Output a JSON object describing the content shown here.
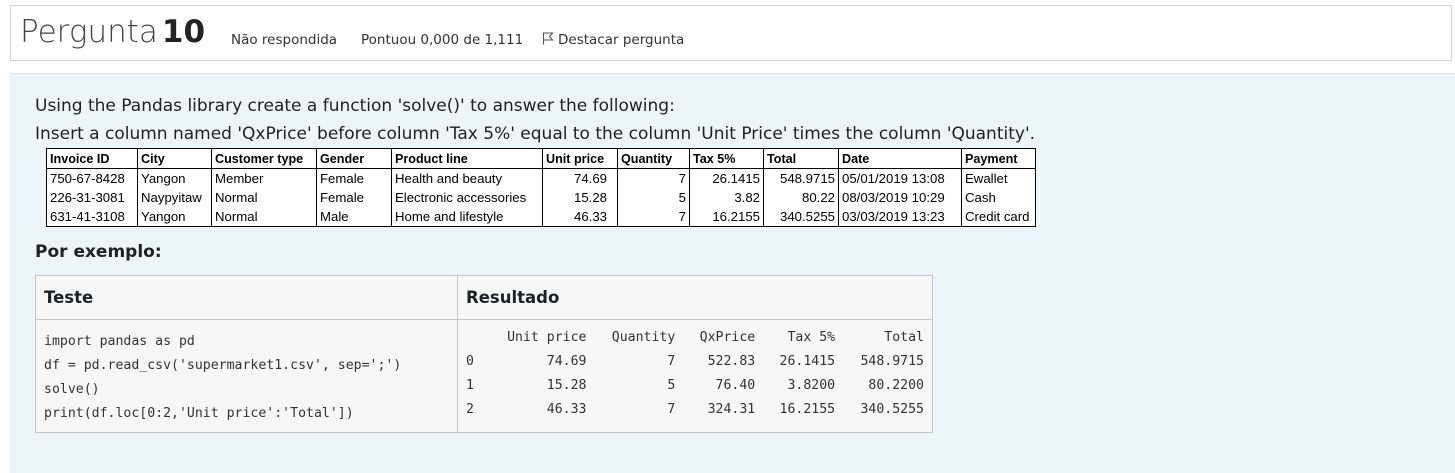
{
  "question": {
    "label": "Pergunta",
    "number": "10",
    "status": "Não respondida",
    "score": "Pontuou 0,000 de 1,111",
    "flag_label": "Destacar pergunta",
    "flag_icon": "flag-outline-icon"
  },
  "prompt": {
    "line1": "Using the Pandas library create a function 'solve()' to answer the following:",
    "line2": "Insert a column named 'QxPrice' before column 'Tax 5%' equal to the column 'Unit Price' times the column 'Quantity'."
  },
  "data_table": {
    "headers": [
      "Invoice ID",
      "City",
      "Customer type",
      "Gender",
      "Product line",
      "Unit price",
      "Quantity",
      "Tax 5%",
      "Total",
      "Date",
      "Payment"
    ],
    "rows": [
      [
        "750-67-8428",
        "Yangon",
        "Member",
        "Female",
        "Health and beauty",
        "74.69",
        "7",
        "26.1415",
        "548.9715",
        "05/01/2019 13:08",
        "Ewallet"
      ],
      [
        "226-31-3081",
        "Naypyitaw",
        "Normal",
        "Female",
        "Electronic accessories",
        "15.28",
        "5",
        "3.82",
        "80.22",
        "08/03/2019 10:29",
        "Cash"
      ],
      [
        "631-41-3108",
        "Yangon",
        "Normal",
        "Male",
        "Home and lifestyle",
        "46.33",
        "7",
        "16.2155",
        "340.5255",
        "03/03/2019 13:23",
        "Credit card"
      ]
    ]
  },
  "example": {
    "label": "Por exemplo:",
    "col_test": "Teste",
    "col_result": "Resultado",
    "code_lines": [
      "import pandas as pd",
      "df = pd.read_csv('supermarket1.csv', sep=';')",
      "solve()",
      "print(df.loc[0:2,'Unit price':'Total'])"
    ],
    "result_headers": [
      "",
      "Unit price",
      "Quantity",
      "QxPrice",
      "Tax 5%",
      "Total"
    ],
    "result_rows": [
      [
        "0",
        "74.69",
        "7",
        "522.83",
        "26.1415",
        "548.9715"
      ],
      [
        "1",
        "15.28",
        "5",
        "76.40",
        "3.8200",
        "80.2200"
      ],
      [
        "2",
        "46.33",
        "7",
        "324.31",
        "16.2155",
        "340.5255"
      ]
    ]
  }
}
